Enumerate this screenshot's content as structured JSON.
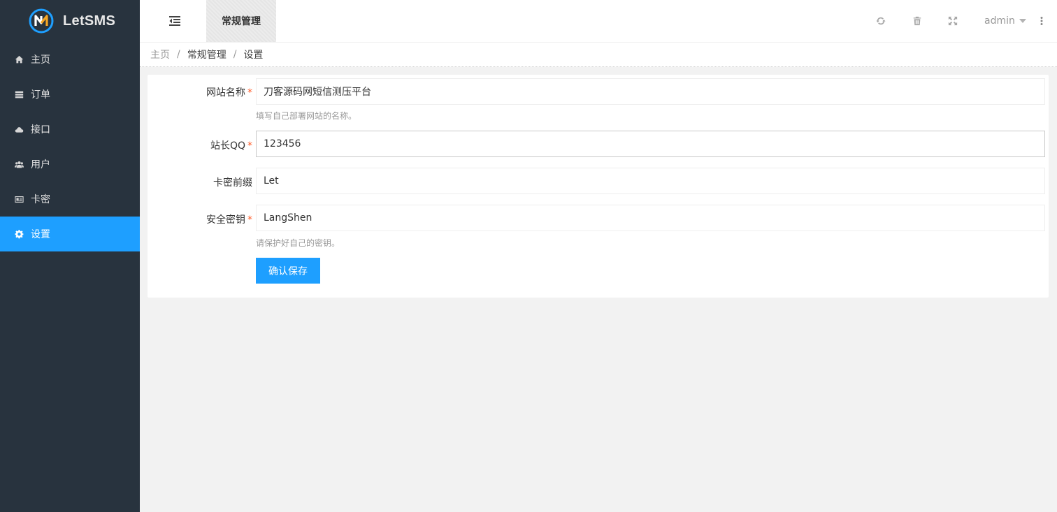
{
  "app": {
    "name": "LetSMS"
  },
  "sidebar": {
    "items": [
      {
        "label": "主页",
        "icon": "home-icon"
      },
      {
        "label": "订单",
        "icon": "list-icon"
      },
      {
        "label": "接口",
        "icon": "cloud-icon"
      },
      {
        "label": "用户",
        "icon": "users-icon"
      },
      {
        "label": "卡密",
        "icon": "card-icon"
      },
      {
        "label": "设置",
        "icon": "gear-icon",
        "active": true
      }
    ]
  },
  "header": {
    "tab": "常规管理",
    "icons": [
      "refresh-icon",
      "trash-icon",
      "fullscreen-icon"
    ],
    "user": "admin"
  },
  "breadcrumb": [
    "主页",
    "常规管理",
    "设置"
  ],
  "form": {
    "site_name": {
      "label": "网站名称",
      "required": "*",
      "value": "刀客源码网短信测压平台",
      "hint": "填写自己部署网站的名称。"
    },
    "qq": {
      "label": "站长QQ",
      "required": "*",
      "value": "123456"
    },
    "card_prefix": {
      "label": "卡密前缀",
      "value": "Let"
    },
    "secret": {
      "label": "安全密钥",
      "required": "*",
      "value": "LangShen",
      "hint": "请保护好自己的密钥。"
    },
    "submit": "确认保存"
  },
  "colors": {
    "sidebar_bg": "#28333e",
    "accent": "#1e9fff",
    "required": "#ff5722"
  }
}
